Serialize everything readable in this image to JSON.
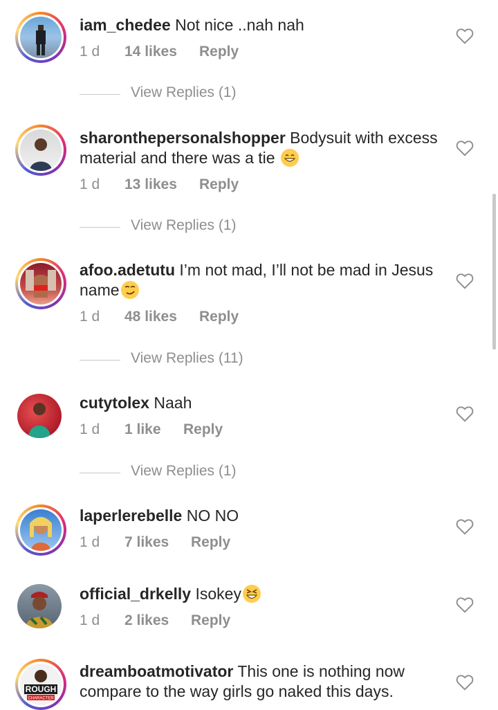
{
  "comments": [
    {
      "username": "iam_chedee",
      "text": "Not nice ..nah nah",
      "time": "1 d",
      "likes": "14 likes",
      "reply": "Reply",
      "view_replies": "View Replies (1)"
    },
    {
      "username": "sharonthepersonalshopper",
      "text": "Bodysuit with excess material and there was a tie",
      "time": "1 d",
      "likes": "13 likes",
      "reply": "Reply",
      "view_replies": "View Replies (1)"
    },
    {
      "username": "afoo.adetutu",
      "text": "I’m not mad, I’ll not be mad in Jesus name",
      "time": "1 d",
      "likes": "48 likes",
      "reply": "Reply",
      "view_replies": "View Replies (11)"
    },
    {
      "username": "cutytolex",
      "text": "Naah",
      "time": "1 d",
      "likes": "1 like",
      "reply": "Reply",
      "view_replies": "View Replies (1)"
    },
    {
      "username": "laperlerebelle",
      "text": "NO NO",
      "time": "1 d",
      "likes": "7 likes",
      "reply": "Reply"
    },
    {
      "username": "official_drkelly",
      "text": "Isokey",
      "time": "1 d",
      "likes": "2 likes",
      "reply": "Reply"
    },
    {
      "username": "dreamboatmotivator",
      "text": "This one is nothing now compare to the way girls go naked this days.",
      "avatar_logo": "ROUGH",
      "avatar_logo_sub": "CHARACTER"
    }
  ],
  "icons": {
    "like": "heart-outline-icon",
    "emoji": "smiling-face-emoji"
  },
  "colors": {
    "username": "#262626",
    "meta": "#8e8e8e",
    "heart": "#8e8e8e",
    "ring": "#dd2a7b"
  }
}
